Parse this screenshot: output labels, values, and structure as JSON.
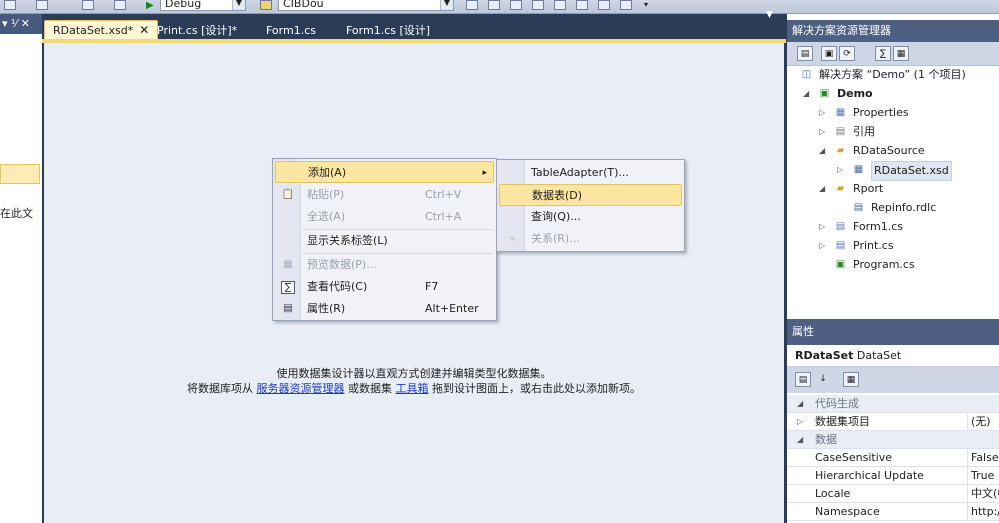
{
  "toolbar": {
    "config": "Debug",
    "platform": "CIBDou"
  },
  "left_panel": {
    "header": "▾ ⅟ ✕",
    "text": "在此文"
  },
  "tabs": [
    {
      "label": "RDataSet.xsd*",
      "active": true,
      "close": "✕"
    },
    {
      "label": "Print.cs [设计]*"
    },
    {
      "label": "Form1.cs"
    },
    {
      "label": "Form1.cs [设计]"
    }
  ],
  "designer": {
    "hint_line1": "使用数据集设计器以直观方式创建并编辑类型化数据集。",
    "hint_prefix": "将数据库项从",
    "hint_link1": "服务器资源管理器",
    "hint_mid": "或数据集",
    "hint_link2": "工具箱",
    "hint_suffix": "拖到设计图面上，或右击此处以添加新项。"
  },
  "context_menu": {
    "items": [
      {
        "label": "添加(A)",
        "shortcut": "",
        "icon": "add-icon",
        "submenu": "▸"
      },
      {
        "label": "粘贴(P)",
        "shortcut": "Ctrl+V",
        "icon": "paste-icon",
        "disabled": true
      },
      {
        "label": "全选(A)",
        "shortcut": "Ctrl+A",
        "icon": "",
        "disabled": true
      },
      {
        "label": "显示关系标签(L)",
        "shortcut": "",
        "icon": ""
      },
      {
        "label": "预览数据(P)...",
        "shortcut": "",
        "icon": "preview-icon",
        "disabled": true
      },
      {
        "label": "查看代码(C)",
        "shortcut": "F7",
        "icon": "code-icon"
      },
      {
        "label": "属性(R)",
        "shortcut": "Alt+Enter",
        "icon": "properties-icon"
      }
    ]
  },
  "submenu": {
    "items": [
      {
        "label": "TableAdapter(T)..."
      },
      {
        "label": "数据表(D)",
        "highlighted": true
      },
      {
        "label": "查询(Q)..."
      },
      {
        "label": "关系(R)...",
        "disabled": true
      }
    ]
  },
  "solution_explorer": {
    "title": "解决方案资源管理器",
    "nodes": [
      {
        "label": "解决方案 “Demo” (1 个项目)"
      },
      {
        "label": "Demo"
      },
      {
        "label": "Properties"
      },
      {
        "label": "引用"
      },
      {
        "label": "RDataSource"
      },
      {
        "label": "RDataSet.xsd"
      },
      {
        "label": "Rport"
      },
      {
        "label": "Repinfo.rdlc"
      },
      {
        "label": "Form1.cs"
      },
      {
        "label": "Print.cs"
      },
      {
        "label": "Program.cs"
      }
    ]
  },
  "properties": {
    "title": "属性",
    "object_name": "RDataSet",
    "object_type": "DataSet",
    "rows": [
      {
        "name": "代码生成",
        "value": "",
        "category": true
      },
      {
        "name": "数据集项目",
        "value": "(无)"
      },
      {
        "name": "数据",
        "value": "",
        "category": true
      },
      {
        "name": "CaseSensitive",
        "value": "False"
      },
      {
        "name": "Hierarchical Update",
        "value": "True"
      },
      {
        "name": "Locale",
        "value": "中文(中"
      },
      {
        "name": "Namespace",
        "value": "http://"
      }
    ]
  },
  "colors": {
    "ide_background": "#2b3c59",
    "active_tab": "#fff6d6",
    "menu_highlight": "#fbe6a2",
    "link": "#1a3ccb"
  }
}
